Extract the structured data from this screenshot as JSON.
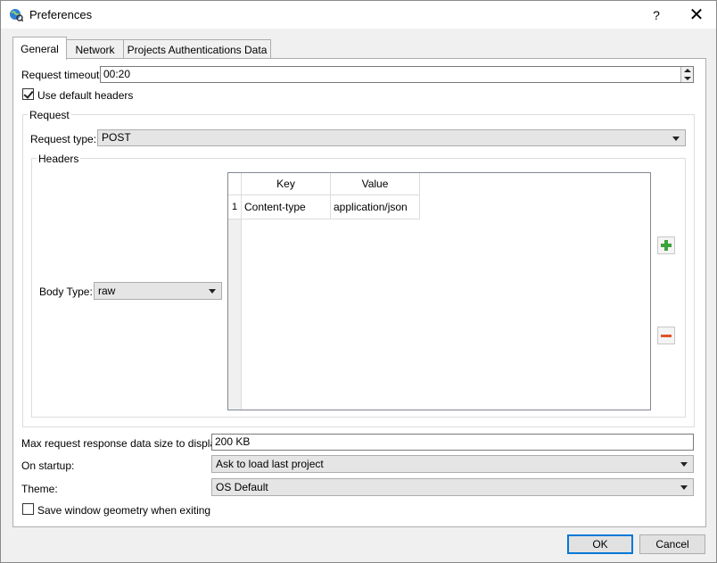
{
  "window": {
    "title": "Preferences",
    "help": "?",
    "close": "✕"
  },
  "tabs": [
    {
      "label": "General",
      "active": true
    },
    {
      "label": "Network",
      "active": false
    },
    {
      "label": "Projects Authentications Data",
      "active": false
    }
  ],
  "general": {
    "request_timeout_label": "Request timeout:",
    "request_timeout_value": "00:20",
    "use_default_headers_label": "Use default headers",
    "use_default_headers_checked": true,
    "request_group_title": "Request",
    "request_type_label": "Request type:",
    "request_type_value": "POST",
    "headers_group_title": "Headers",
    "body_type_label": "Body Type:",
    "body_type_value": "raw",
    "headers_table": {
      "columns": [
        "Key",
        "Value"
      ],
      "rows": [
        {
          "index": "1",
          "key": "Content-type",
          "value": "application/json"
        }
      ]
    },
    "max_size_label": "Max request response data size to display:",
    "max_size_value": "200 KB",
    "on_startup_label": "On startup:",
    "on_startup_value": "Ask to load last project",
    "theme_label": "Theme:",
    "theme_value": "OS Default",
    "save_geometry_label": "Save window geometry when exiting",
    "save_geometry_checked": false
  },
  "buttons": {
    "ok": "OK",
    "cancel": "Cancel"
  },
  "colors": {
    "accent": "#0078d7",
    "add_icon": "#3aa33a",
    "remove_icon": "#e0522a"
  }
}
